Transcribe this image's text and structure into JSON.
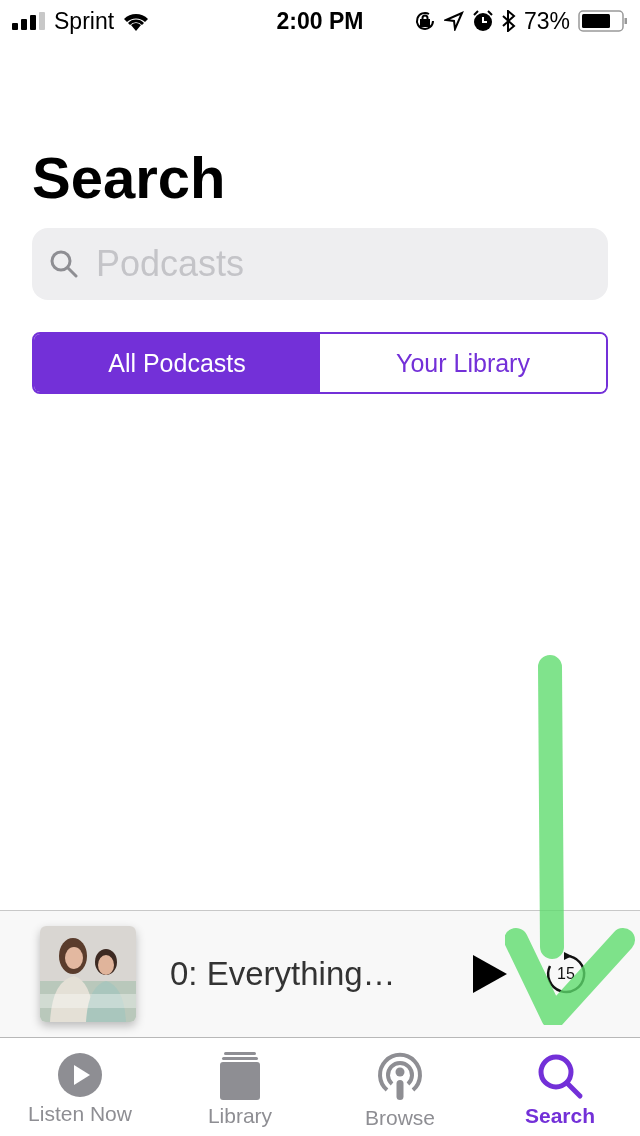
{
  "status_bar": {
    "carrier": "Sprint",
    "time": "2:00 PM",
    "battery": "73%"
  },
  "title": "Search",
  "search": {
    "placeholder": "Podcasts"
  },
  "scopes": [
    {
      "label": "All Podcasts",
      "selected": true
    },
    {
      "label": "Your Library",
      "selected": false
    }
  ],
  "now_playing": {
    "title": "0: Everything…",
    "skip_label": "15"
  },
  "tabs": [
    {
      "label": "Listen Now",
      "kind": "play",
      "selected": false
    },
    {
      "label": "Library",
      "kind": "library",
      "selected": false
    },
    {
      "label": "Browse",
      "kind": "podcast",
      "selected": false
    },
    {
      "label": "Search",
      "kind": "search",
      "selected": true
    }
  ],
  "annotation": {
    "kind": "arrow"
  }
}
